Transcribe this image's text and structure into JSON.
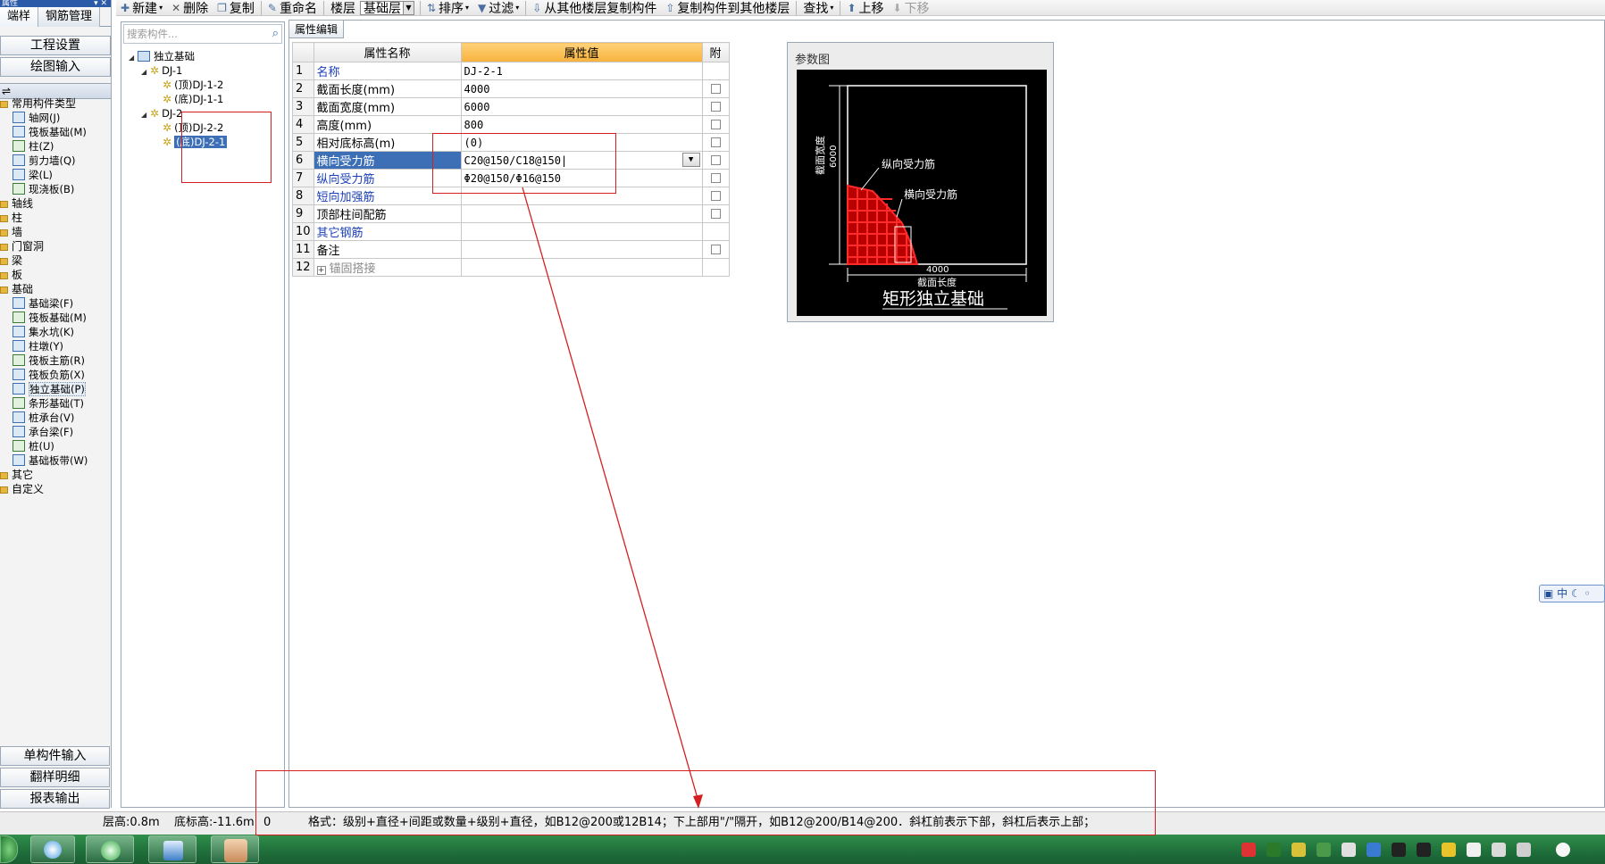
{
  "left_panel": {
    "title": "属性",
    "tabs": [
      "端样",
      "钢筋管理"
    ],
    "nav_top": [
      "工程设置",
      "绘图输入"
    ],
    "nav_bottom": [
      "单构件输入",
      "翻样明细",
      "报表输出"
    ],
    "tree": [
      {
        "label": "常用构件类型",
        "type": "folder"
      },
      {
        "label": "轴网(J)",
        "type": "child"
      },
      {
        "label": "筏板基础(M)",
        "type": "child"
      },
      {
        "label": "柱(Z)",
        "type": "child"
      },
      {
        "label": "剪力墙(Q)",
        "type": "child"
      },
      {
        "label": "梁(L)",
        "type": "child"
      },
      {
        "label": "现浇板(B)",
        "type": "child"
      },
      {
        "label": "轴线",
        "type": "folder"
      },
      {
        "label": "柱",
        "type": "folder"
      },
      {
        "label": "墙",
        "type": "folder"
      },
      {
        "label": "门窗洞",
        "type": "folder"
      },
      {
        "label": "梁",
        "type": "folder"
      },
      {
        "label": "板",
        "type": "folder"
      },
      {
        "label": "基础",
        "type": "folder"
      },
      {
        "label": "基础梁(F)",
        "type": "child"
      },
      {
        "label": "筏板基础(M)",
        "type": "child"
      },
      {
        "label": "集水坑(K)",
        "type": "child"
      },
      {
        "label": "柱墩(Y)",
        "type": "child"
      },
      {
        "label": "筏板主筋(R)",
        "type": "child"
      },
      {
        "label": "筏板负筋(X)",
        "type": "child"
      },
      {
        "label": "独立基础(P)",
        "type": "child",
        "selected": true
      },
      {
        "label": "条形基础(T)",
        "type": "child"
      },
      {
        "label": "桩承台(V)",
        "type": "child"
      },
      {
        "label": "承台梁(F)",
        "type": "child"
      },
      {
        "label": "桩(U)",
        "type": "child"
      },
      {
        "label": "基础板带(W)",
        "type": "child"
      },
      {
        "label": "其它",
        "type": "folder"
      },
      {
        "label": "自定义",
        "type": "folder"
      }
    ]
  },
  "toolbar": {
    "new_label": "新建",
    "delete_label": "删除",
    "copy_label": "复制",
    "rename_label": "重命名",
    "floor_label": "楼层",
    "floor_value": "基础层",
    "sort_label": "排序",
    "filter_label": "过滤",
    "copy_from_floor_label": "从其他楼层复制构件",
    "copy_to_floor_label": "复制构件到其他楼层",
    "find_label": "查找",
    "move_up_label": "上移",
    "move_down_label": "下移"
  },
  "component_tree": {
    "search_placeholder": "搜索构件...",
    "root": "独立基础",
    "groups": [
      {
        "name": "DJ-1",
        "items": [
          "(顶)DJ-1-2",
          "(底)DJ-1-1"
        ]
      },
      {
        "name": "DJ-2",
        "items": [
          "(顶)DJ-2-2",
          "(底)DJ-2-1"
        ]
      }
    ]
  },
  "property_editor": {
    "tab_label": "属性编辑",
    "col_name": "属性名称",
    "col_value": "属性值",
    "col_attach": "附",
    "rows": [
      {
        "idx": "1",
        "name": "名称",
        "value": "DJ-2-1",
        "link": true,
        "check": false
      },
      {
        "idx": "2",
        "name": "截面长度(mm)",
        "value": "4000",
        "link": false,
        "check": true
      },
      {
        "idx": "3",
        "name": "截面宽度(mm)",
        "value": "6000",
        "link": false,
        "check": true
      },
      {
        "idx": "4",
        "name": "高度(mm)",
        "value": "800",
        "link": false,
        "check": true
      },
      {
        "idx": "5",
        "name": "相对底标高(m)",
        "value": "(0)",
        "link": false,
        "check": true
      },
      {
        "idx": "6",
        "name": "横向受力筋",
        "value": "C20@150/C18@150",
        "link": true,
        "check": true,
        "selected": true
      },
      {
        "idx": "7",
        "name": "纵向受力筋",
        "value": "Φ20@150/Φ16@150",
        "link": true,
        "check": true
      },
      {
        "idx": "8",
        "name": "短向加强筋",
        "value": "",
        "link": true,
        "check": true
      },
      {
        "idx": "9",
        "name": "顶部柱间配筋",
        "value": "",
        "link": false,
        "check": true
      },
      {
        "idx": "10",
        "name": "其它钢筋",
        "value": "",
        "link": true,
        "check": false
      },
      {
        "idx": "11",
        "name": "备注",
        "value": "",
        "link": false,
        "check": true
      },
      {
        "idx": "12",
        "name": "锚固搭接",
        "value": "",
        "link": false,
        "check": false,
        "gray": true,
        "expandable": true
      }
    ]
  },
  "diagram": {
    "title": "参数图",
    "width_label": "截面宽度",
    "width_value": "6000",
    "length_value": "4000",
    "length_label": "截面长度",
    "longitudinal_label": "纵向受力筋",
    "transverse_label": "横向受力筋",
    "caption": "矩形独立基础"
  },
  "ime": {
    "label": "中"
  },
  "statusbar": {
    "floor_height": "层高:0.8m",
    "base_elevation": "底标高:-11.6m",
    "zero": "0",
    "hint": "格式：级别+直径+间距或数量+级别+直径，如B12@200或12B14；下上部用\"/\"隔开，如B12@200/B14@200．斜杠前表示下部，斜杠后表示上部；"
  },
  "colors": {
    "accent_blue": "#3d6fb6",
    "header_orange": "#f7b13c",
    "annotation_red": "#d42020",
    "taskbar_green": "#1f6e3a"
  }
}
